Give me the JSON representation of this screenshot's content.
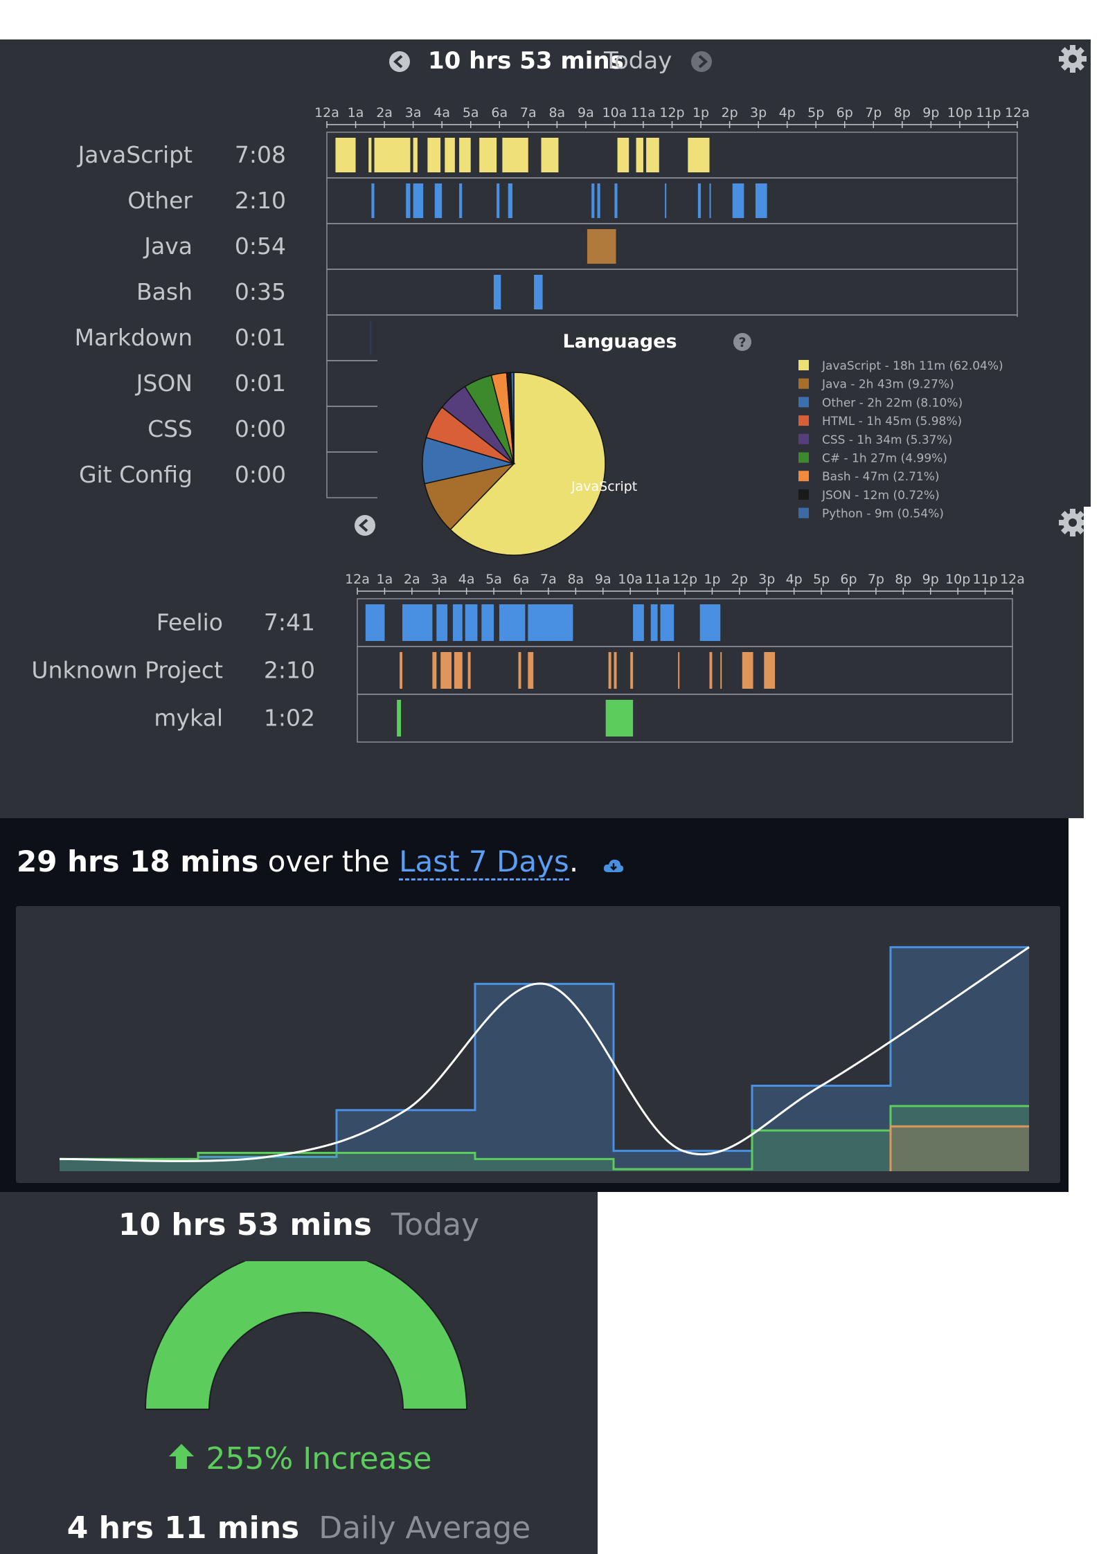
{
  "day_header": {
    "duration": "10 hrs 53 mins",
    "period": "Today"
  },
  "hour_ticks": [
    "12a",
    "1a",
    "2a",
    "3a",
    "4a",
    "5a",
    "6a",
    "7a",
    "8a",
    "9a",
    "10a",
    "11a",
    "12p",
    "1p",
    "2p",
    "3p",
    "4p",
    "5p",
    "6p",
    "7p",
    "8p",
    "9p",
    "10p",
    "11p",
    "12a"
  ],
  "languages_timeline": [
    {
      "name": "JavaScript",
      "total": "7:08",
      "color": "#f0e07a"
    },
    {
      "name": "Other",
      "total": "2:10",
      "color": "#4a90e2"
    },
    {
      "name": "Java",
      "total": "0:54",
      "color": "#b07a3c"
    },
    {
      "name": "Bash",
      "total": "0:35",
      "color": "#4a90e2"
    },
    {
      "name": "Markdown",
      "total": "0:01",
      "color": "#2b3a66"
    },
    {
      "name": "JSON",
      "total": "0:01",
      "color": "#4a90e2"
    },
    {
      "name": "CSS",
      "total": "0:00",
      "color": "#6b4a9a"
    },
    {
      "name": "Git Config",
      "total": "0:00",
      "color": "#4a90e2"
    }
  ],
  "languages_pie": {
    "title": "Languages",
    "slice_label": "JavaScript",
    "entries": [
      {
        "label": "JavaScript - 18h 11m (62.04%)",
        "value": 62.04,
        "color": "#ece073"
      },
      {
        "label": "Java - 2h 43m (9.27%)",
        "value": 9.27,
        "color": "#a86e2c"
      },
      {
        "label": "Other - 2h 22m (8.10%)",
        "value": 8.1,
        "color": "#3a6fb0"
      },
      {
        "label": "HTML - 1h 45m (5.98%)",
        "value": 5.98,
        "color": "#d95f36"
      },
      {
        "label": "CSS - 1h 34m (5.37%)",
        "value": 5.37,
        "color": "#563d7c"
      },
      {
        "label": "C# - 1h 27m (4.99%)",
        "value": 4.99,
        "color": "#3d8a2c"
      },
      {
        "label": "Bash - 47m (2.71%)",
        "value": 2.71,
        "color": "#f28a3c"
      },
      {
        "label": "JSON - 12m (0.72%)",
        "value": 0.72,
        "color": "#1a1a1a"
      },
      {
        "label": "Python - 9m (0.54%)",
        "value": 0.54,
        "color": "#3b6aa6"
      }
    ]
  },
  "projects_timeline": [
    {
      "name": "Feelio",
      "total": "7:41",
      "color": "#4a90e2"
    },
    {
      "name": "Unknown Project",
      "total": "2:10",
      "color": "#e0965a"
    },
    {
      "name": "mykal",
      "total": "1:02",
      "color": "#5ccd5c"
    }
  ],
  "weekly": {
    "duration": "29 hrs 18 mins",
    "over_the": "over the",
    "range_link": "Last 7 Days",
    "period": "."
  },
  "weekly_chart": {
    "type": "area",
    "days": 7,
    "series": [
      {
        "color": "#4a90e2",
        "values": [
          0.3,
          0.35,
          1.5,
          4.6,
          0.5,
          2.1,
          5.5
        ]
      },
      {
        "color": "#5ccd5c",
        "values": [
          0.3,
          0.45,
          0.45,
          0.3,
          0.05,
          1.0,
          1.6
        ]
      },
      {
        "color": "#e0965a",
        "values": [
          0,
          0,
          0,
          0,
          0,
          0,
          1.1
        ]
      }
    ],
    "ylim": [
      0,
      6
    ]
  },
  "daily_summary": {
    "today_duration": "10 hrs 53 mins",
    "today_label": "Today",
    "change_text": "255% Increase",
    "gauge_percent": 100,
    "avg_duration": "4 hrs 11 mins",
    "avg_label": "Daily Average",
    "gauge_color": "#5ccd5c"
  }
}
